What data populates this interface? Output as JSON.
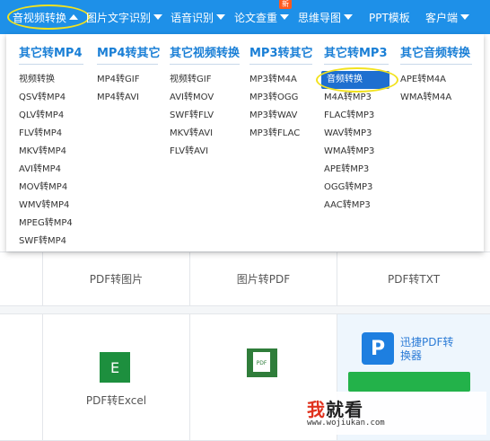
{
  "nav": {
    "items": [
      {
        "label": "音视频转换",
        "active": true
      },
      {
        "label": "图片文字识别"
      },
      {
        "label": "语音识别"
      },
      {
        "label": "论文查重",
        "badge": "新"
      },
      {
        "label": "思维导图"
      },
      {
        "label": "PPT模板"
      },
      {
        "label": "客户端"
      }
    ]
  },
  "dropdown": {
    "columns": [
      {
        "title": "其它转MP4",
        "items": [
          "视频转换",
          "QSV转MP4",
          "QLV转MP4",
          "FLV转MP4",
          "MKV转MP4",
          "AVI转MP4",
          "MOV转MP4",
          "WMV转MP4",
          "MPEG转MP4",
          "SWF转MP4"
        ]
      },
      {
        "title": "MP4转其它",
        "items": [
          "MP4转GIF",
          "MP4转AVI"
        ]
      },
      {
        "title": "其它视频转换",
        "items": [
          "视频转GIF",
          "AVI转MOV",
          "SWF转FLV",
          "MKV转AVI",
          "FLV转AVI"
        ]
      },
      {
        "title": "MP3转其它",
        "items": [
          "MP3转M4A",
          "MP3转OGG",
          "MP3转WAV",
          "MP3转FLAC"
        ]
      },
      {
        "title": "其它转MP3",
        "items": [
          "音频转换",
          "M4A转MP3",
          "FLAC转MP3",
          "WAV转MP3",
          "WMA转MP3",
          "APE转MP3",
          "OGG转MP3",
          "AAC转MP3"
        ],
        "highlighted": "音频转换"
      },
      {
        "title": "其它音频转换",
        "items": [
          "APE转M4A",
          "WMA转M4A"
        ]
      }
    ]
  },
  "grid": {
    "row1": [
      "PDF转图片",
      "图片转PDF",
      "PDF转TXT"
    ],
    "row2": [
      "PDF转Excel"
    ],
    "excel_letter": "E",
    "pdf_sheet_text": "PDF",
    "promo_logo_letter": "P",
    "promo_title": "迅捷PDF转换器"
  },
  "watermark": {
    "red": "我",
    "black": "就看",
    "url": "www.wojiukan.com"
  },
  "colors": {
    "nav_bg": "#1e90e8",
    "column_head": "#1a7fd6",
    "highlight": "#1e6fd0",
    "ring": "#f2e21f",
    "badge": "#ff5a1f"
  }
}
